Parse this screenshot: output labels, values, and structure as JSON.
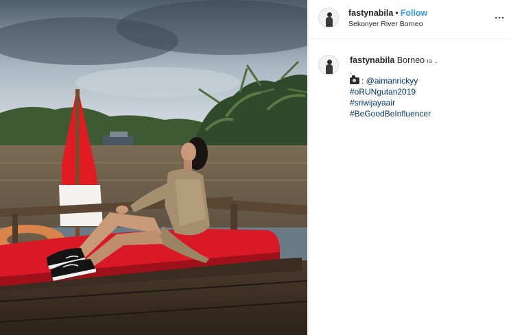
{
  "post": {
    "image_alt": "Woman in khaki outfit sitting on red cushion on boat deck with red and white flag on river"
  },
  "header": {
    "username": "fastynabila",
    "separator": "•",
    "follow_label": "Follow",
    "location": "Sekonyer River Borneo",
    "more_label": "..."
  },
  "caption": {
    "username": "fastynabila",
    "text": "Borneo",
    "flag": "ID",
    "trailing": ".",
    "dot_line": ".",
    "credit_prefix": ": ",
    "mention": "@aimanrickyy",
    "hashtags": [
      "#oRUNgutan2019",
      "#sriwijayaair",
      "#BeGoodBeInfluencer"
    ]
  },
  "colors": {
    "follow": "#3897f0",
    "link": "#003569",
    "cushion": "#d91a26"
  }
}
